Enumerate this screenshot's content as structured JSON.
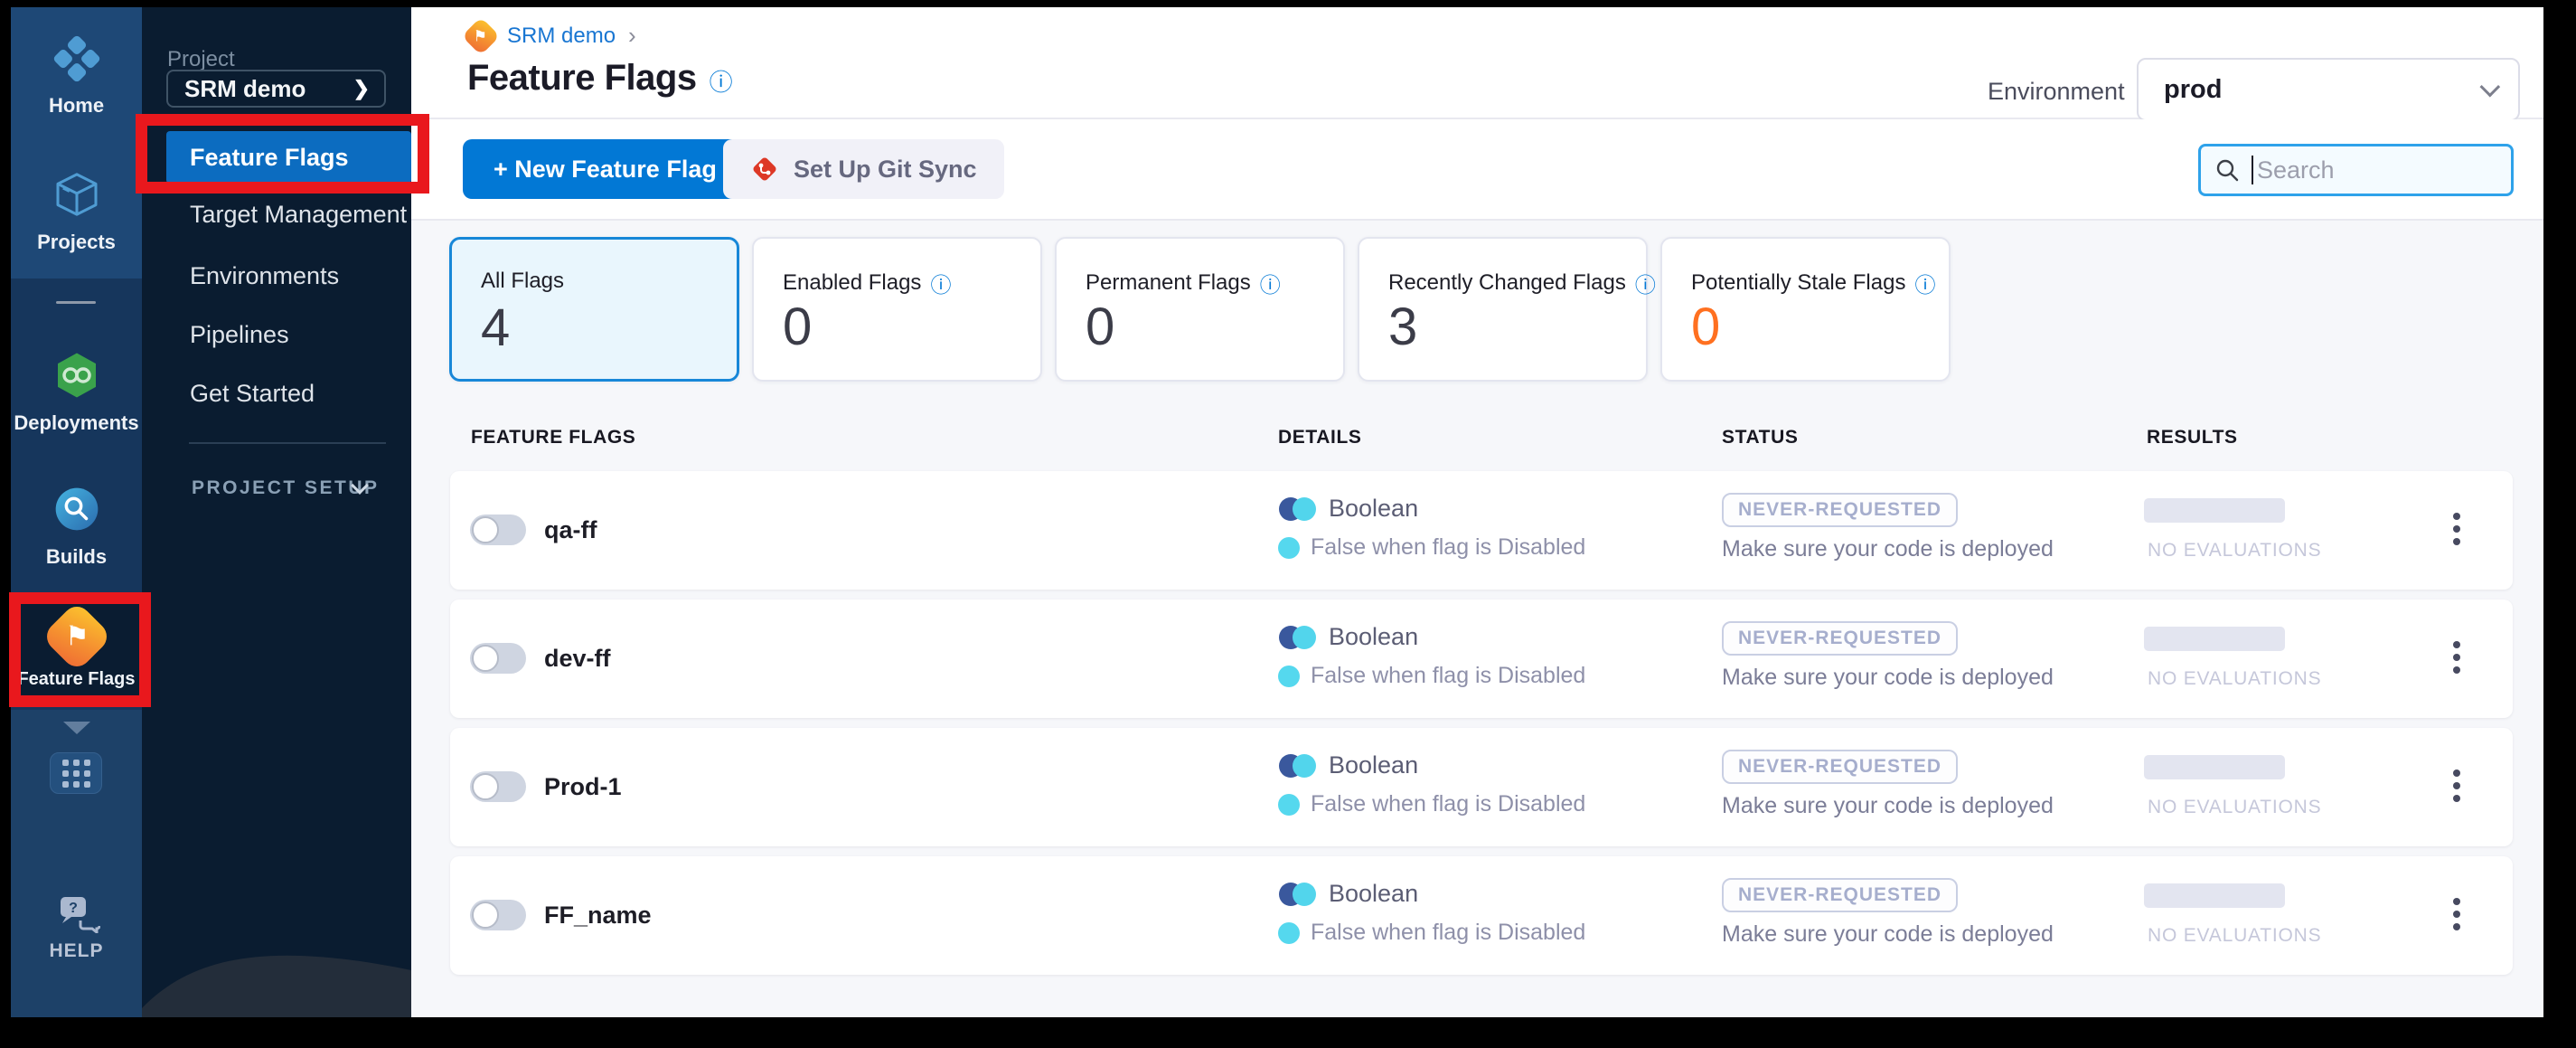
{
  "module_nav": {
    "items": [
      {
        "label": "Home"
      },
      {
        "label": "Projects"
      },
      {
        "label": "Deployments"
      },
      {
        "label": "Builds"
      },
      {
        "label": "Feature Flags"
      }
    ],
    "help_label": "HELP"
  },
  "project_nav": {
    "section_label": "Project",
    "project_name": "SRM demo",
    "project_chevron": "❯",
    "active_item": "Feature Flags",
    "items": [
      {
        "label": "Target Management"
      },
      {
        "label": "Environments"
      },
      {
        "label": "Pipelines"
      },
      {
        "label": "Get Started"
      }
    ],
    "setup_label": "PROJECT SETUP"
  },
  "header": {
    "breadcrumb_project": "SRM demo",
    "breadcrumb_chevron": "›",
    "title": "Feature Flags",
    "info_icon": "ⓘ",
    "environment_label": "Environment",
    "environment_value": "prod"
  },
  "toolbar": {
    "new_flag_label": "+ New Feature Flag",
    "git_sync_label": "Set Up Git Sync",
    "search_placeholder": "Search"
  },
  "cards": [
    {
      "label": "All Flags",
      "value": "4"
    },
    {
      "label": "Enabled Flags",
      "value": "0",
      "info": "ⓘ"
    },
    {
      "label": "Permanent Flags",
      "value": "0",
      "info": "ⓘ"
    },
    {
      "label": "Recently Changed Flags",
      "value": "3",
      "info": "ⓘ"
    },
    {
      "label": "Potentially Stale Flags",
      "value": "0",
      "info": "ⓘ",
      "value_style": "color:#ff7020"
    }
  ],
  "table": {
    "headers": {
      "flags": "FEATURE FLAGS",
      "details": "DETAILS",
      "status": "STATUS",
      "results": "RESULTS"
    },
    "row_common": {
      "type": "Boolean",
      "off_rule": "False when flag is Disabled",
      "badge": "NEVER-REQUESTED",
      "status_note": "Make sure your code is deployed",
      "results_note": "NO EVALUATIONS"
    },
    "rows": [
      {
        "name": "qa-ff"
      },
      {
        "name": "dev-ff"
      },
      {
        "name": "Prod-1"
      },
      {
        "name": "FF_name"
      }
    ]
  }
}
